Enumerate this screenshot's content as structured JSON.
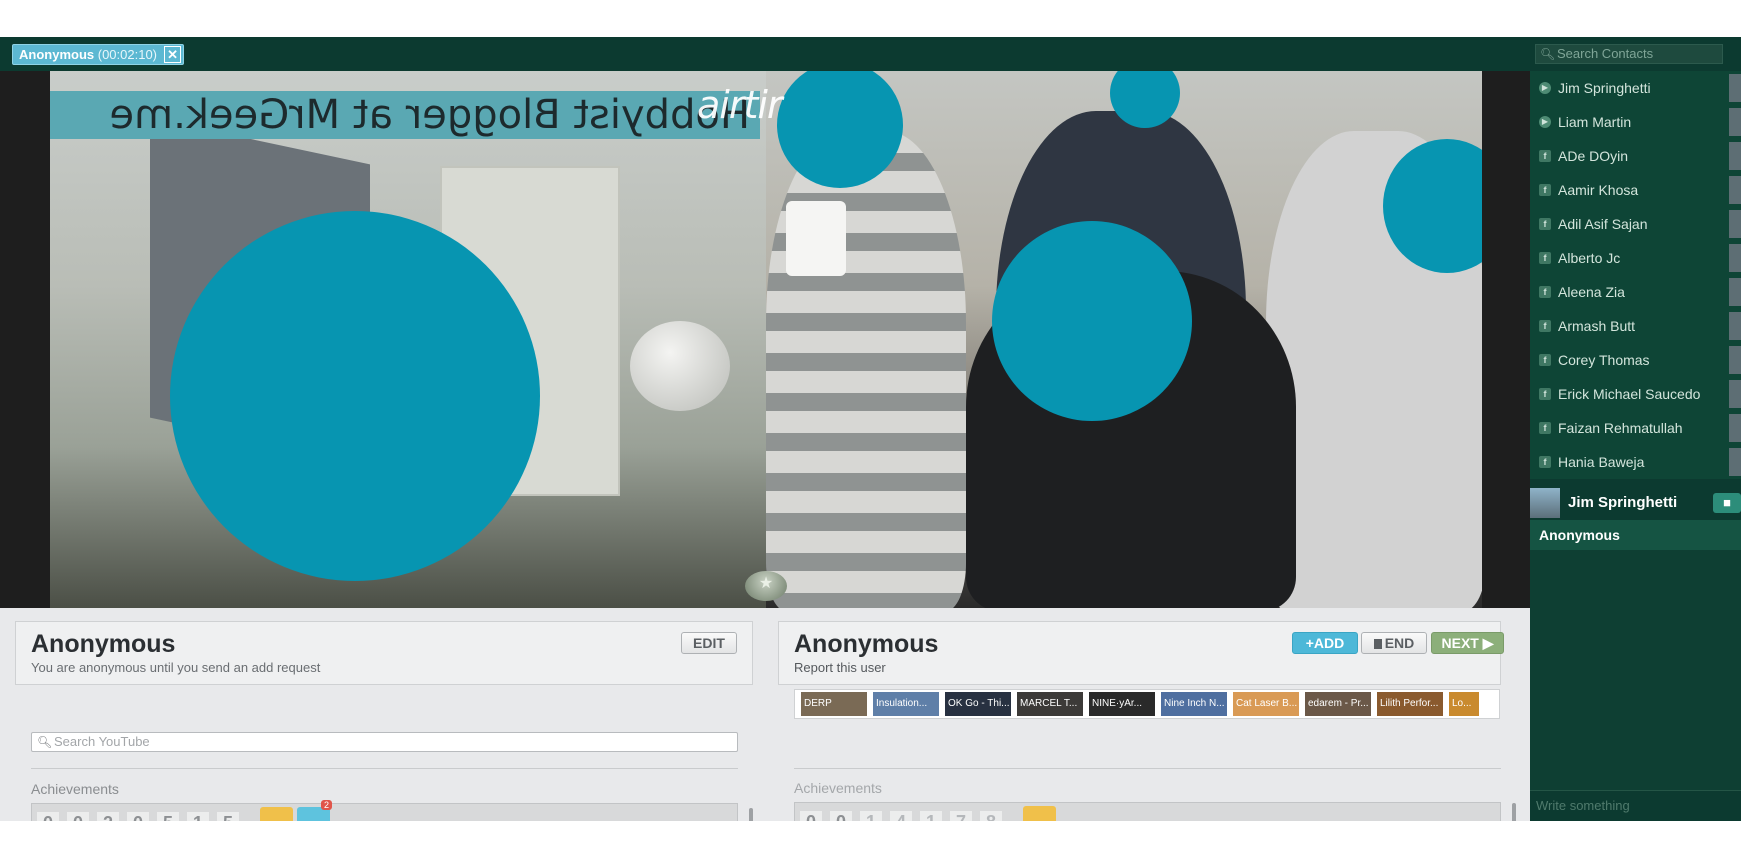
{
  "session_tab": {
    "name": "Anonymous",
    "time": "(00:02:10)"
  },
  "video": {
    "banner_text": "Hobbyist Blogger at MrGeek.me",
    "watermark": "airtir"
  },
  "self_panel": {
    "name": "Anonymous",
    "subtext": "You are anonymous until you send an add request",
    "edit_label": "EDIT",
    "youtube_search_placeholder": "Search YouTube",
    "achievements_label": "Achievements",
    "achievement_digits": [
      "0",
      "0",
      "2",
      "0",
      "5",
      "1",
      "5"
    ],
    "badge_count": "2"
  },
  "peer_panel": {
    "name": "Anonymous",
    "report_label": "Report this user",
    "add_label": "+ADD",
    "end_label": "END",
    "next_label": "NEXT",
    "videos": [
      "DERP",
      "Insulation...",
      "OK Go - Thi...",
      "MARCEL T...",
      "NINE·yAr...",
      "Nine Inch N...",
      "Cat Laser B...",
      "edarem - Pr...",
      "Lilith Perfor...",
      "Lo..."
    ],
    "achievements_label": "Achievements",
    "achievement_digits": [
      "0",
      "0",
      "1",
      "4",
      "1",
      "7",
      "8"
    ]
  },
  "sidebar": {
    "search_placeholder": "Search Contacts",
    "contacts": [
      {
        "name": "Jim Springhetti",
        "type": "online"
      },
      {
        "name": "Liam Martin",
        "type": "online"
      },
      {
        "name": "ADe DOyin",
        "type": "facebook"
      },
      {
        "name": "Aamir Khosa",
        "type": "facebook"
      },
      {
        "name": "Adil Asif Sajan",
        "type": "facebook"
      },
      {
        "name": "Alberto Jc",
        "type": "facebook"
      },
      {
        "name": "Aleena Zia",
        "type": "facebook"
      },
      {
        "name": "Armash Butt",
        "type": "facebook"
      },
      {
        "name": "Corey Thomas",
        "type": "facebook"
      },
      {
        "name": "Erick Michael Saucedo",
        "type": "facebook"
      },
      {
        "name": "Faizan Rehmatullah",
        "type": "facebook"
      },
      {
        "name": "Hania Baweja",
        "type": "facebook"
      }
    ],
    "chat_contact": "Jim Springhetti",
    "chat_peer": "Anonymous",
    "chat_placeholder": "Write something"
  },
  "colors": {
    "accent": "#0795b1",
    "sidebar_bg": "#0c3a30",
    "add_button": "#4db8d8",
    "next_button": "#8caf7a"
  },
  "icons": [
    "close-icon",
    "search-icon",
    "video-camera-icon",
    "star-icon",
    "facebook-icon",
    "online-icon"
  ]
}
